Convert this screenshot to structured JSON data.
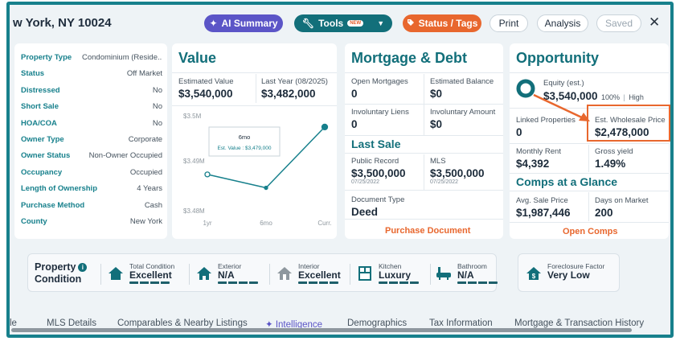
{
  "header": {
    "title": "w York, NY 10024",
    "ai_summary": "AI Summary",
    "tools": "Tools",
    "tools_badge": "NEW",
    "status_tags": "Status / Tags",
    "print": "Print",
    "analysis": "Analysis",
    "saved": "Saved",
    "close": "✕"
  },
  "property": {
    "rows": [
      {
        "label": "Property Type",
        "value": "Condominium (Reside..."
      },
      {
        "label": "Status",
        "value": "Off Market"
      },
      {
        "label": "Distressed",
        "value": "No"
      },
      {
        "label": "Short Sale",
        "value": "No"
      },
      {
        "label": "HOA/COA",
        "value": "No"
      },
      {
        "label": "Owner Type",
        "value": "Corporate"
      },
      {
        "label": "Owner Status",
        "value": "Non-Owner Occupied"
      },
      {
        "label": "Occupancy",
        "value": "Occupied"
      },
      {
        "label": "Length of Ownership",
        "value": "4 Years"
      },
      {
        "label": "Purchase Method",
        "value": "Cash"
      },
      {
        "label": "County",
        "value": "New York"
      }
    ]
  },
  "value": {
    "title": "Value",
    "estimated_label": "Estimated Value",
    "estimated_value": "$3,540,000",
    "last_year_label": "Last Year (08/2025)",
    "last_year_value": "$3,482,000"
  },
  "chart_data": {
    "type": "line",
    "categories": [
      "1yr",
      "6mo",
      "Curr."
    ],
    "values": [
      3455000,
      3431000,
      3540000
    ],
    "ylim": [
      3390000,
      3560000
    ],
    "yticks": [
      3400000,
      3480000,
      3500000
    ],
    "ytick_labels": [
      "$3.48M",
      "$3.49M",
      "$3.5M"
    ],
    "tooltip": {
      "title": "6mo",
      "text": "Est. Value : $3,479,000"
    },
    "line_color": "#17808c"
  },
  "mortgage": {
    "title": "Mortgage & Debt",
    "open_mortgages_label": "Open Mortgages",
    "open_mortgages_value": "0",
    "est_balance_label": "Estimated Balance",
    "est_balance_value": "$0",
    "liens_label": "Involuntary Liens",
    "liens_value": "0",
    "liens_amount_label": "Involuntary Amount",
    "liens_amount_value": "$0",
    "last_sale_title": "Last Sale",
    "public_record_label": "Public Record",
    "public_record_value": "$3,500,000",
    "public_record_date": "07/25/2022",
    "mls_label": "MLS",
    "mls_value": "$3,500,000",
    "mls_date": "07/25/2022",
    "doc_type_label": "Document Type",
    "doc_type_value": "Deed",
    "purchase_doc_link": "Purchase Document"
  },
  "opportunity": {
    "title": "Opportunity",
    "equity_label": "Equity (est.)",
    "equity_value": "$3,540,000",
    "equity_pct": "100%",
    "equity_level": "High",
    "linked_label": "Linked Properties",
    "linked_value": "0",
    "wholesale_label": "Est. Wholesale Price",
    "wholesale_value": "$2,478,000",
    "rent_label": "Monthly Rent",
    "rent_value": "$4,392",
    "yield_label": "Gross yield",
    "yield_value": "1.49%",
    "comps_title": "Comps at a Glance",
    "avg_sale_label": "Avg. Sale Price",
    "avg_sale_value": "$1,987,446",
    "days_label": "Days on Market",
    "days_value": "200",
    "open_comps_link": "Open Comps"
  },
  "condition": {
    "label_line1": "Property",
    "label_line2": "Condition",
    "items": [
      {
        "label": "Total Condition",
        "value": "Excellent"
      },
      {
        "label": "Exterior",
        "value": "N/A"
      },
      {
        "label": "Interior",
        "value": "Excellent"
      },
      {
        "label": "Kitchen",
        "value": "Luxury"
      },
      {
        "label": "Bathroom",
        "value": "N/A"
      }
    ],
    "foreclosure_label": "Foreclosure Factor",
    "foreclosure_value": "Very Low"
  },
  "tabs": [
    "le",
    "MLS Details",
    "Comparables & Nearby Listings",
    "Intelligence",
    "Demographics",
    "Tax Information",
    "Mortgage & Transaction History"
  ],
  "colors": {
    "teal": "#126f7a",
    "orange": "#e8672e",
    "purple": "#5b55c7"
  }
}
